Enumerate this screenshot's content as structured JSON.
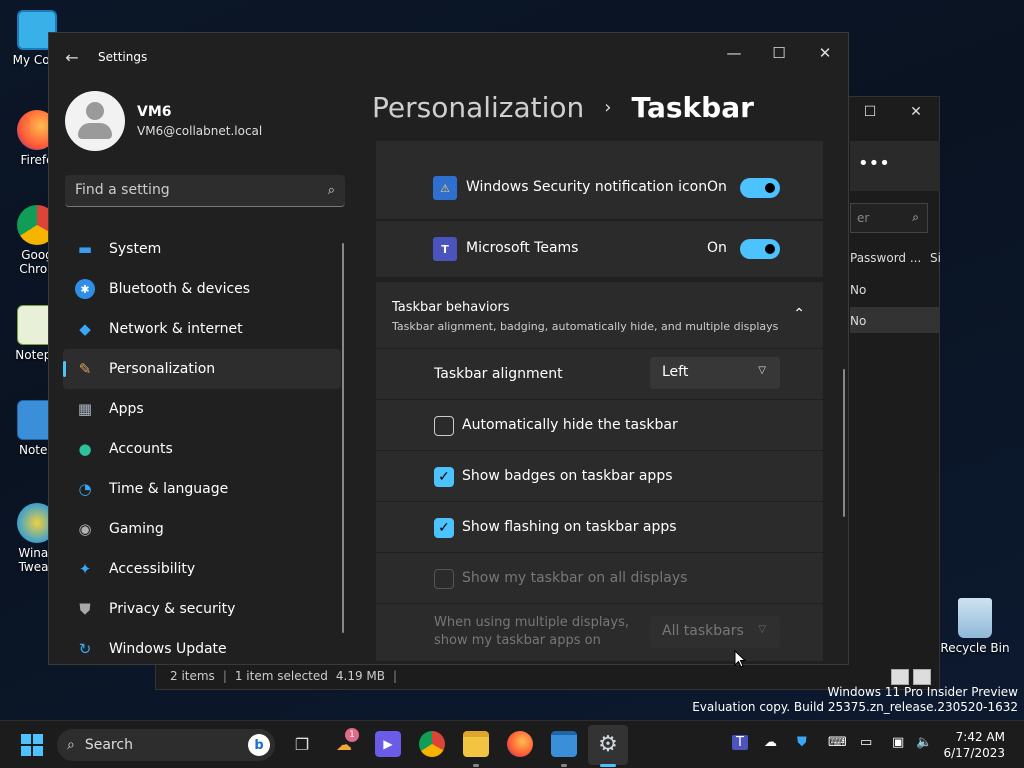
{
  "desktop": {
    "icons": [
      {
        "label": "My Com"
      },
      {
        "label": "Firefo"
      },
      {
        "label": "Goog Chron"
      },
      {
        "label": "Notepa"
      },
      {
        "label": "Notep"
      },
      {
        "label": "Winae Tweak"
      },
      {
        "label": "Recycle Bin"
      }
    ]
  },
  "background_window": {
    "search_placeholder": "er",
    "columns": [
      "Password ...",
      "Si"
    ],
    "rows": [
      "No",
      "No"
    ],
    "status": {
      "items": "2 items",
      "selected": "1 item selected",
      "size": "4.19 MB",
      "sep": "|"
    }
  },
  "settings": {
    "app_title": "Settings",
    "back_glyph": "←",
    "controls": {
      "minimize": "—",
      "maximize": "☐",
      "close": "✕"
    },
    "profile": {
      "name": "VM6",
      "email": "VM6@collabnet.local"
    },
    "search": {
      "placeholder": "Find a setting",
      "icon": "⌕"
    },
    "nav": [
      {
        "label": "System",
        "icon": "▬",
        "color": "#3a9df0"
      },
      {
        "label": "Bluetooth & devices",
        "icon": "✱",
        "color": "#2f8fe8"
      },
      {
        "label": "Network & internet",
        "icon": "◆",
        "color": "#3aa7f5"
      },
      {
        "label": "Personalization",
        "icon": "✎",
        "color": "#e0a060",
        "active": true
      },
      {
        "label": "Apps",
        "icon": "▦",
        "color": "#a9b4c4"
      },
      {
        "label": "Accounts",
        "icon": "●",
        "color": "#2ebf9b"
      },
      {
        "label": "Time & language",
        "icon": "◔",
        "color": "#3aa7f5"
      },
      {
        "label": "Gaming",
        "icon": "◉",
        "color": "#b0b0b0"
      },
      {
        "label": "Accessibility",
        "icon": "✦",
        "color": "#3aa7f5"
      },
      {
        "label": "Privacy & security",
        "icon": "⛊",
        "color": "#a9a9a9"
      },
      {
        "label": "Windows Update",
        "icon": "↻",
        "color": "#3aa7f5"
      }
    ],
    "header": {
      "parent": "Personalization",
      "separator": "›",
      "current": "Taskbar"
    },
    "tray_rows": [
      {
        "label": "Windows Security notification icon",
        "state": "On",
        "icon_color": "#2f6fd0"
      },
      {
        "label": "Microsoft Teams",
        "state": "On",
        "icon_color": "#4b53bc",
        "icon_text": "T"
      }
    ],
    "behaviors": {
      "title": "Taskbar behaviors",
      "subtitle": "Taskbar alignment, badging, automatically hide, and multiple displays",
      "alignment": {
        "label": "Taskbar alignment",
        "value": "Left"
      },
      "checkboxes": [
        {
          "label": "Automatically hide the taskbar",
          "checked": false,
          "disabled": false
        },
        {
          "label": "Show badges on taskbar apps",
          "checked": true,
          "disabled": false
        },
        {
          "label": "Show flashing on taskbar apps",
          "checked": true,
          "disabled": false
        },
        {
          "label": "Show my taskbar on all displays",
          "checked": false,
          "disabled": true
        }
      ],
      "multi_display": {
        "line1": "When using multiple displays,",
        "line2": "show my taskbar apps on",
        "value": "All taskbars"
      }
    }
  },
  "watermark": {
    "line1": "Windows 11 Pro Insider Preview",
    "line2": "Evaluation copy. Build 25375.zn_release.230520-1632"
  },
  "taskbar": {
    "search_label": "Search",
    "badge_count": "1",
    "clock": {
      "time": "7:42 AM",
      "date": "6/17/2023"
    }
  }
}
